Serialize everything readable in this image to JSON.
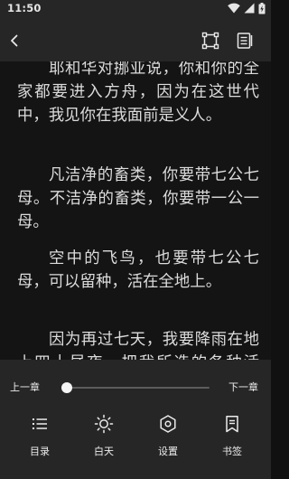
{
  "status_bar": {
    "time": "11:50"
  },
  "icons": {
    "back": "back-arrow-icon",
    "frame": "fullscreen-frame-icon",
    "book": "book-details-icon",
    "wifi": "wifi-icon",
    "cellular": "cellular-signal-icon",
    "battery": "battery-charging-icon",
    "toc": "list-icon",
    "day": "sun-icon",
    "settings": "hexagon-settings-icon",
    "bookmark": "bookmark-icon"
  },
  "content": {
    "paragraphs": [
      "耶和华对挪亚说，你和你的全家都要进入方舟，因为在这世代中，我见你在我面前是义人。",
      "凡洁净的畜类，你要带七公七母。不洁净的畜类，你要带一公一母。",
      "空中的飞鸟，也要带七公七母，可以留种，活在全地上。",
      "因为再过七天，我要降雨在地上四十昼夜，把我所造的各种活物，都从地上除灭。"
    ]
  },
  "chapter_nav": {
    "prev_label": "上一章",
    "next_label": "下一章",
    "progress": 0
  },
  "bottom_nav": {
    "toc_label": "目录",
    "day_label": "白天",
    "settings_label": "设置",
    "bookmark_label": "书签"
  },
  "colors": {
    "panel_background": "#262626",
    "reading_background": "#141414",
    "text": "#dcdcdc",
    "accent": "#ffffff"
  }
}
